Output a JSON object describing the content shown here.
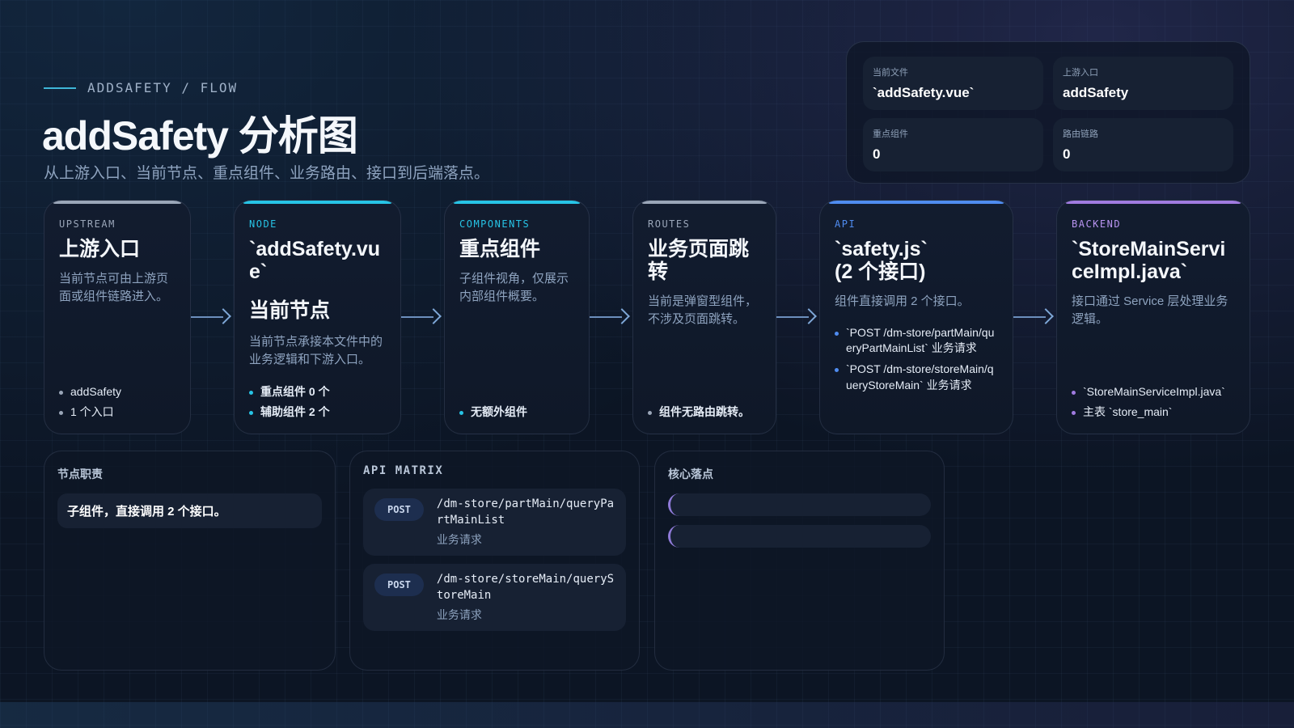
{
  "header": {
    "eyebrow": "ADDSAFETY / FLOW",
    "title": "addSafety 分析图",
    "subtitle": "从上游入口、当前节点、重点组件、业务路由、接口到后端落点。"
  },
  "summary": [
    {
      "label": "当前文件",
      "value": "`addSafety.vue`"
    },
    {
      "label": "上游入口",
      "value": "addSafety"
    },
    {
      "label": "重点组件",
      "value": "0"
    },
    {
      "label": "路由链路",
      "value": "0"
    }
  ],
  "cards": {
    "upstream": {
      "tag": "UPSTREAM",
      "title": "上游入口",
      "desc": "当前节点可由上游页面或组件链路进入。",
      "items": [
        "addSafety",
        "1 个入口"
      ]
    },
    "node": {
      "tag": "NODE",
      "title": "`addSafety.vue`",
      "title2": "当前节点",
      "desc": "当前节点承接本文件中的业务逻辑和下游入口。",
      "items": [
        "重点组件 0 个",
        "辅助组件 2 个"
      ]
    },
    "components": {
      "tag": "COMPONENTS",
      "title": "重点组件",
      "desc": "子组件视角，仅展示内部组件概要。",
      "items": [
        "无额外组件"
      ]
    },
    "routes": {
      "tag": "ROUTES",
      "title": "业务页面跳转",
      "desc": "当前是弹窗型组件，不涉及页面跳转。",
      "items": [
        "组件无路由跳转。"
      ]
    },
    "api": {
      "tag": "API",
      "title": "`safety.js`",
      "title_line2": "(2 个接口)",
      "desc": "组件直接调用 2 个接口。",
      "items": [
        "`POST /dm-store/partMain/queryPartMainList` 业务请求",
        "`POST /dm-store/storeMain/queryStoreMain` 业务请求"
      ]
    },
    "backend": {
      "tag": "BACKEND",
      "title": "`StoreMainServiceImpl.java`",
      "desc": "接口通过 Service 层处理业务逻辑。",
      "items": [
        "`StoreMainServiceImpl.java`",
        "主表 `store_main`"
      ]
    }
  },
  "panels": {
    "duty": {
      "title": "节点职责",
      "text": "子组件，直接调用 2 个接口。"
    },
    "api_matrix": {
      "title": "API MATRIX",
      "items": [
        {
          "method": "POST",
          "path": "/dm-store/partMain/queryPartMainList",
          "note": "业务请求"
        },
        {
          "method": "POST",
          "path": "/dm-store/storeMain/queryStoreMain",
          "note": "业务请求"
        }
      ]
    },
    "core": {
      "title": "核心落点"
    }
  },
  "colors": {
    "upstream": "#9aa6b8",
    "node": "#27c4e6",
    "components": "#27c4e6",
    "routes": "#9aa6b8",
    "api": "#4f8cf0",
    "backend": "#a07be0"
  }
}
